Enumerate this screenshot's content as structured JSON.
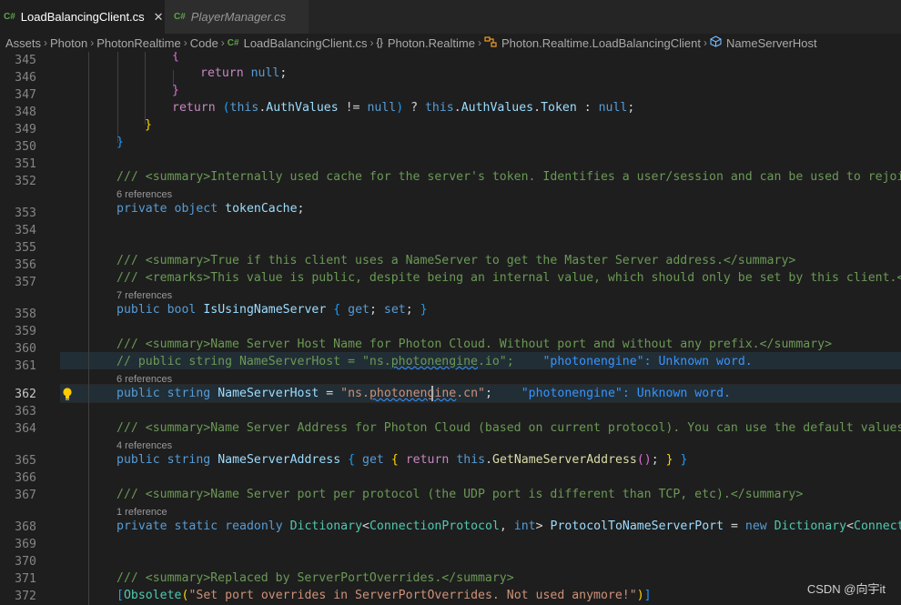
{
  "tabs": [
    {
      "icon": "C#",
      "label": "LoadBalancingClient.cs",
      "close": "✕"
    },
    {
      "icon": "C#",
      "label": "PlayerManager.cs"
    }
  ],
  "breadcrumb": {
    "items": [
      "Assets",
      "Photon",
      "PhotonRealtime",
      "Code"
    ],
    "file_icon": "C#",
    "file": "LoadBalancingClient.cs",
    "ns_icon": "{}",
    "namespace": "Photon.Realtime",
    "class_icon": "class-icon",
    "class": "Photon.Realtime.LoadBalancingClient",
    "member_icon": "field-icon",
    "member": "NameServerHost",
    "separator": "›"
  },
  "editor": {
    "current_line": "362",
    "line_numbers": [
      "345",
      "346",
      "347",
      "348",
      "349",
      "350",
      "351",
      "352",
      "353",
      "354",
      "355",
      "356",
      "357",
      "358",
      "359",
      "360",
      "361",
      "362",
      "363",
      "364",
      "365",
      "366",
      "367",
      "368",
      "369",
      "370",
      "371",
      "372"
    ],
    "code_lens": {
      "l352": "6 references",
      "l357": "7 references",
      "l361": "6 references",
      "l364": "4 references",
      "l367": "1 reference"
    },
    "lines": {
      "l345": "{",
      "l346a": "return",
      "l346b": "null",
      "l347": "}",
      "l348a": "return",
      "l348b": "this",
      "l348c": "AuthValues",
      "l348d": "null",
      "l348e": "this",
      "l348f": "AuthValues",
      "l348g": "Token",
      "l348h": "null",
      "l349": "}",
      "l350": "}",
      "l352": "/// <summary>Internally used cache for the server's token. Identifies a user/session and can be used to rejoin.</",
      "l353a": "private",
      "l353b": "object",
      "l353c": "tokenCache",
      "l356": "/// <summary>True if this client uses a NameServer to get the Master Server address.</summary>",
      "l357": "/// <remarks>This value is public, despite being an internal value, which should only be set by this client.</re",
      "l358a": "public",
      "l358b": "bool",
      "l358c": "IsUsingNameServer",
      "l358d": "get",
      "l358e": "set",
      "l360": "/// <summary>Name Server Host Name for Photon Cloud. Without port and without any prefix.</summary>",
      "l361a": "// public string NameServerHost = \"ns.",
      "l361b": "photonengine",
      "l361c": ".io\";",
      "l361d": "\"photonengine\": Unknown word.",
      "l362a": "public",
      "l362b": "string",
      "l362c": "NameServerHost",
      "l362d": "\"ns.",
      "l362e": "photonengine",
      "l362f": ".cn\"",
      "l362g": "\"photonengine\": Unknown word.",
      "l364": "/// <summary>Name Server Address for Photon Cloud (based on current protocol). You can use the default values an",
      "l365a": "public",
      "l365b": "string",
      "l365c": "NameServerAddress",
      "l365d": "get",
      "l365e": "return",
      "l365f": "this",
      "l365g": "GetNameServerAddress",
      "l367": "/// <summary>Name Server port per protocol (the UDP port is different than TCP, etc).</summary>",
      "l368a": "private",
      "l368b": "static",
      "l368c": "readonly",
      "l368d": "Dictionary",
      "l368e": "ConnectionProtocol",
      "l368f": "int",
      "l368g": "ProtocolToNameServerPort",
      "l368h": "new",
      "l368i": "Dictionary",
      "l368j": "Connection",
      "l371": "/// <summary>Replaced by ServerPortOverrides.</summary>",
      "l372a": "Obsolete",
      "l372b": "\"Set port overrides in ServerPortOverrides. Not used anymore!\""
    }
  },
  "watermark": "CSDN @向宇it",
  "colors": {
    "background": "#1e1e1e",
    "keyword": "#569cd6",
    "comment": "#6a9955",
    "string": "#ce9178",
    "type": "#4ec9b0",
    "diagnostic": "#3794ff"
  }
}
